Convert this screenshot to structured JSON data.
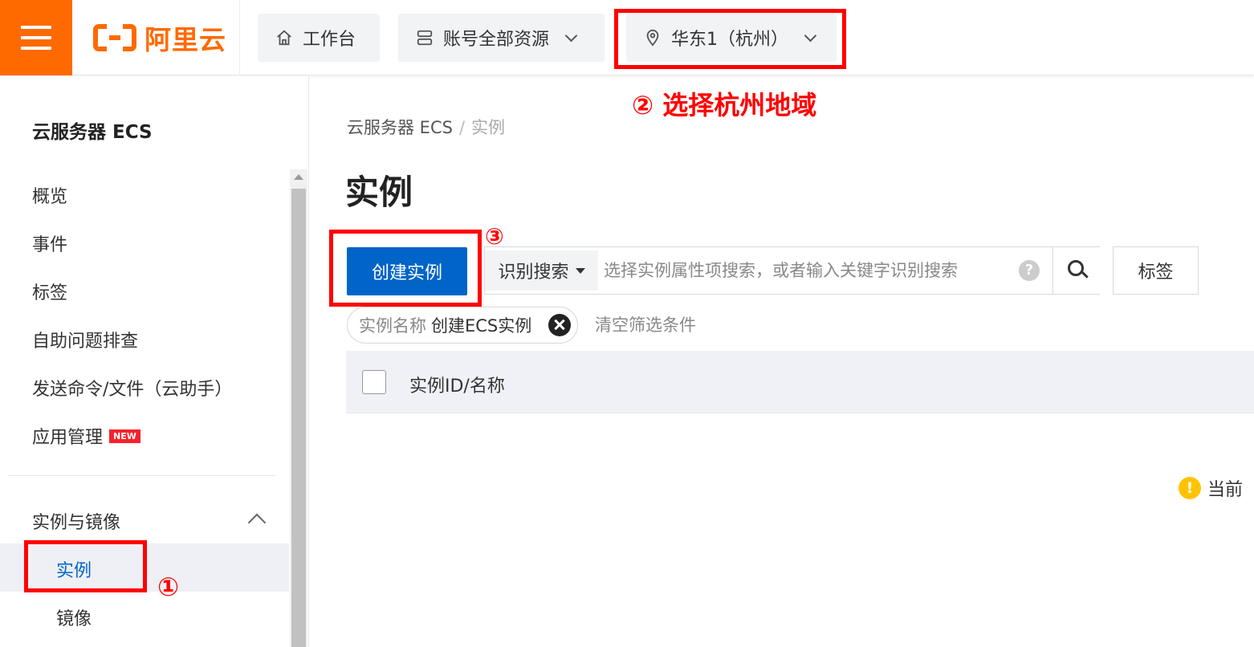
{
  "topbar": {
    "logo_text": "阿里云",
    "workbench": "工作台",
    "resources": "账号全部资源",
    "region": "华东1（杭州）"
  },
  "sidebar": {
    "title": "云服务器 ECS",
    "items": [
      {
        "label": "概览"
      },
      {
        "label": "事件"
      },
      {
        "label": "标签"
      },
      {
        "label": "自助问题排查"
      },
      {
        "label": "发送命令/文件（云助手）"
      },
      {
        "label": "应用管理",
        "badge": "NEW"
      }
    ],
    "group": "实例与镜像",
    "sub_items": [
      {
        "label": "实例",
        "active": true
      },
      {
        "label": "镜像"
      }
    ]
  },
  "breadcrumb": {
    "parent": "云服务器 ECS",
    "separator": "/",
    "current": "实例"
  },
  "page_title": "实例",
  "toolbar": {
    "create_button": "创建实例",
    "search_type": "识别搜索",
    "search_placeholder": "选择实例属性项搜索，或者输入关键字识别搜索",
    "help": "?",
    "tag_button": "标签"
  },
  "filter": {
    "key": "实例名称",
    "value": "创建ECS实例",
    "clear": "清空筛选条件"
  },
  "table": {
    "columns": [
      "实例ID/名称"
    ]
  },
  "notice": {
    "icon": "!",
    "text": "当前"
  },
  "annotations": {
    "step1": "①",
    "step2": "② 选择杭州地域",
    "step3": "③"
  },
  "colors": {
    "brand": "#ff6a00",
    "primary": "#0064c8",
    "annotation": "#ff0000",
    "warning": "#ffc300"
  }
}
